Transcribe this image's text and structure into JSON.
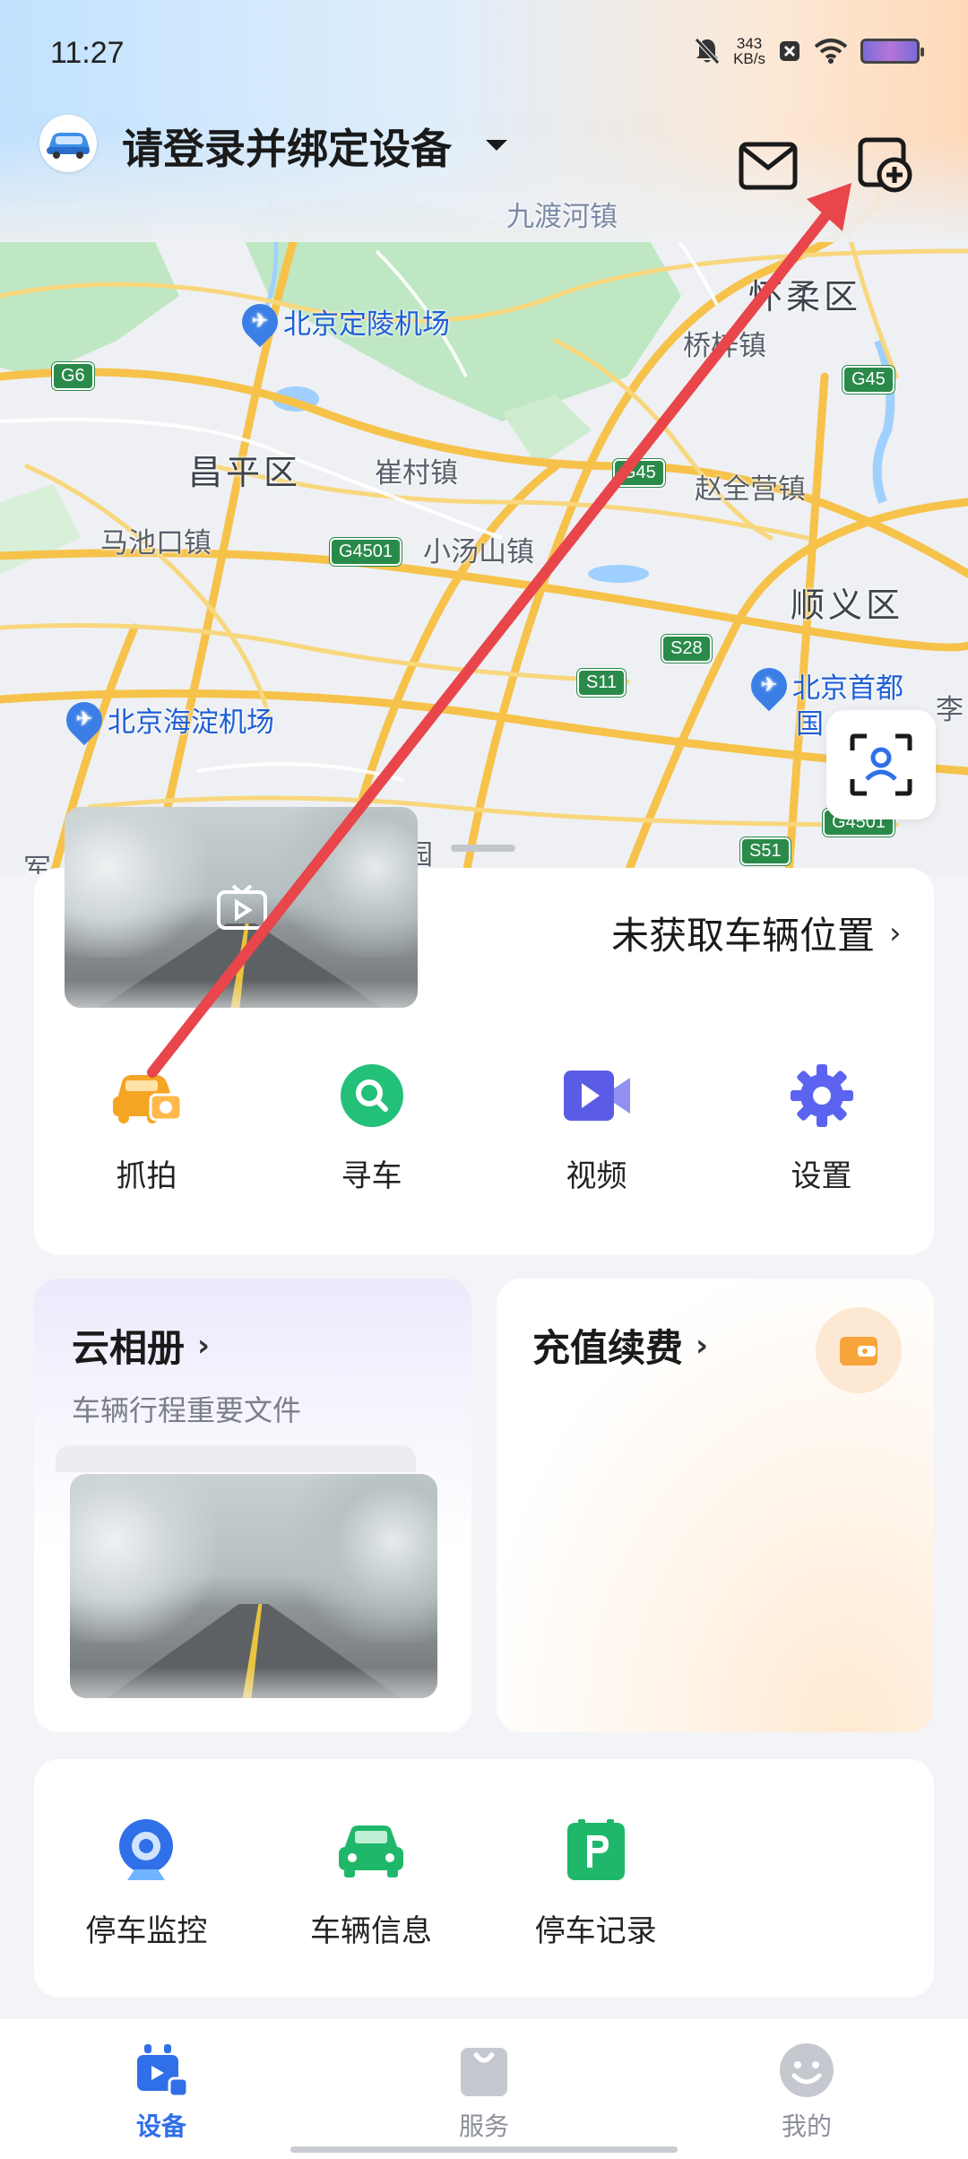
{
  "status_bar": {
    "time": "11:27",
    "net_speed_value": "343",
    "net_speed_unit": "KB/s"
  },
  "header": {
    "title": "请登录并绑定设备",
    "mail_icon": "mail-icon",
    "add_device_icon": "add-device-icon"
  },
  "map": {
    "labels": {
      "jiudu_river": "九渡河镇",
      "huairou": "怀柔区",
      "qiaozi": "桥梓镇",
      "dingling_airport": "北京定陵机场",
      "changping": "昌平区",
      "cuicun": "崔村镇",
      "zhaoquanying": "赵全营镇",
      "machikou": "马池口镇",
      "xiaotangshan": "小汤山镇",
      "shunyi": "顺义区",
      "capital_airport_1": "北京首都",
      "capital_airport_2": "国",
      "capital_airport_3": "李",
      "haidian_airport": "北京海淀机场",
      "junzhuang": "军",
      "partial": "园"
    },
    "roads": {
      "g6": "G6",
      "g45_a": "G45",
      "g45_b": "G45",
      "g4501_a": "G4501",
      "s28": "S28",
      "s11": "S11",
      "g4501_b": "G4501",
      "s51": "S51"
    }
  },
  "vehicle_card": {
    "location_text": "未获取车辆位置",
    "quick_actions": [
      {
        "label": "抓拍",
        "icon": "snapshot-car-icon",
        "color": "#f5a524"
      },
      {
        "label": "寻车",
        "icon": "find-car-icon",
        "color": "#23c07a"
      },
      {
        "label": "视频",
        "icon": "video-icon",
        "color": "#5b5ce6"
      },
      {
        "label": "设置",
        "icon": "settings-gear-icon",
        "color": "#5b63f0"
      }
    ]
  },
  "album_card": {
    "title": "云相册",
    "subtitle": "车辆行程重要文件"
  },
  "recharge_card": {
    "title": "充值续费",
    "icon": "wallet-icon"
  },
  "tools": [
    {
      "label": "停车监控",
      "icon": "parking-monitor-camera-icon",
      "color": "#2f6fe8"
    },
    {
      "label": "车辆信息",
      "icon": "vehicle-info-car-icon",
      "color": "#1fb86a"
    },
    {
      "label": "停车记录",
      "icon": "parking-record-icon",
      "color": "#1fb86a"
    }
  ],
  "bottom_nav": [
    {
      "label": "设备",
      "icon": "device-icon",
      "active": true
    },
    {
      "label": "服务",
      "icon": "service-bag-icon",
      "active": false
    },
    {
      "label": "我的",
      "icon": "profile-smile-icon",
      "active": false
    }
  ],
  "annotation": {
    "color": "#e8464b"
  }
}
